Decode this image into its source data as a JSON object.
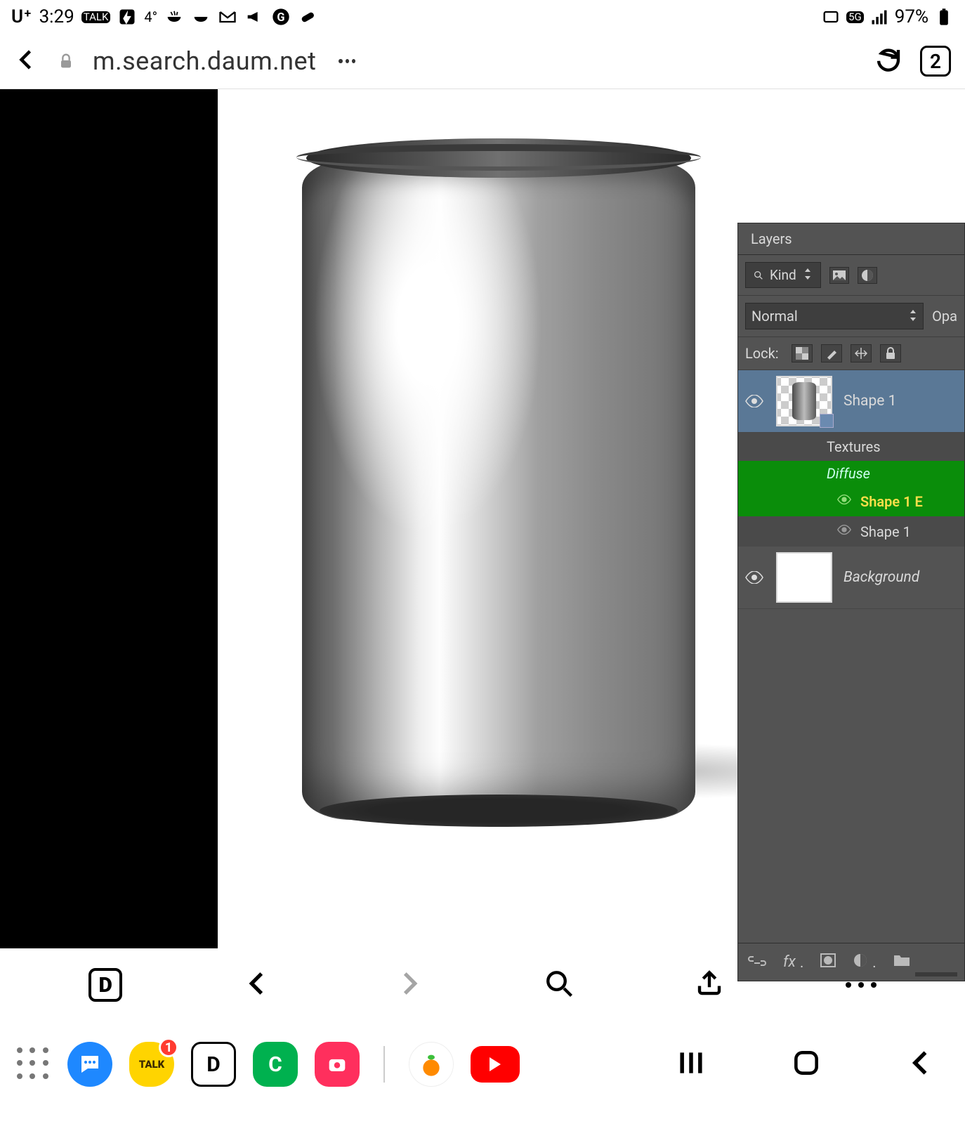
{
  "status": {
    "carrier": "U⁺",
    "time": "3:29",
    "temp": "4°",
    "network_badge": "5G",
    "battery_text": "97%"
  },
  "browser": {
    "url": "m.search.daum.net",
    "tabs_count": "2"
  },
  "layers_panel": {
    "tab": "Layers",
    "filter_label": "Kind",
    "blend_mode": "Normal",
    "opacity_label": "Opa",
    "lock_label": "Lock:",
    "layer1_name": "Shape 1",
    "textures_header": "Textures",
    "diffuse_label": "Diffuse",
    "diffuse_child": "Shape 1 E",
    "shape1_sub": "Shape 1",
    "background_name": "Background",
    "fx": "fx"
  },
  "dock": {
    "talk_badge": "1",
    "talk_label": "TALK",
    "d_label": "D",
    "c_label": "C"
  }
}
